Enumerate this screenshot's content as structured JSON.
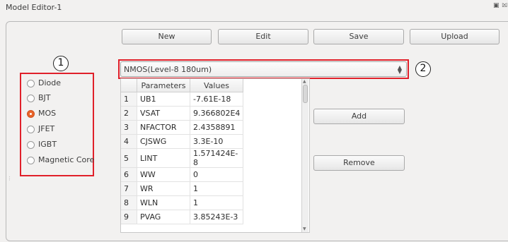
{
  "window": {
    "title": "Model Editor-1"
  },
  "toolbar": {
    "new_label": "New",
    "edit_label": "Edit",
    "save_label": "Save",
    "upload_label": "Upload"
  },
  "device_types": [
    {
      "label": "Diode",
      "selected": false
    },
    {
      "label": "BJT",
      "selected": false
    },
    {
      "label": "MOS",
      "selected": true
    },
    {
      "label": "JFET",
      "selected": false
    },
    {
      "label": "IGBT",
      "selected": false
    },
    {
      "label": "Magnetic Core",
      "selected": false
    }
  ],
  "model_select": {
    "value": "NMOS(Level-8 180um)"
  },
  "table": {
    "headers": [
      "Parameters",
      "Values"
    ],
    "rows": [
      {
        "num": "1",
        "param": "UB1",
        "value": "-7.61E-18"
      },
      {
        "num": "2",
        "param": "VSAT",
        "value": "9.366802E4"
      },
      {
        "num": "3",
        "param": "NFACTOR",
        "value": "2.4358891"
      },
      {
        "num": "4",
        "param": "CJSWG",
        "value": "3.3E-10"
      },
      {
        "num": "5",
        "param": "LINT",
        "value": "1.571424E-8"
      },
      {
        "num": "6",
        "param": "WW",
        "value": "0"
      },
      {
        "num": "7",
        "param": "WR",
        "value": "1"
      },
      {
        "num": "8",
        "param": "WLN",
        "value": "1"
      },
      {
        "num": "9",
        "param": "PVAG",
        "value": "3.85243E-3"
      }
    ]
  },
  "actions": {
    "add_label": "Add",
    "remove_label": "Remove"
  },
  "callouts": {
    "one": "1",
    "two": "2"
  },
  "colors": {
    "highlight": "#e0202a",
    "radio_checked": "#e9642a"
  }
}
